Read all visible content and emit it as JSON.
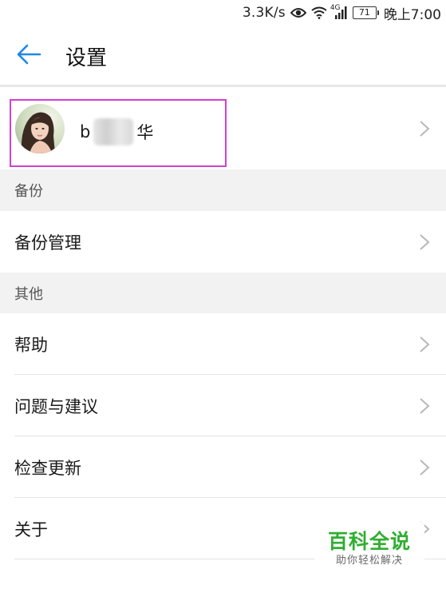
{
  "status_bar": {
    "net_speed": "3.3K/s",
    "network_type": "4G",
    "battery_level": "71",
    "time": "晚上7:00",
    "icons": [
      "eye-icon",
      "wifi-icon",
      "signal-icon",
      "battery-icon"
    ]
  },
  "header": {
    "back_icon": "arrow-left-icon",
    "title": "设置"
  },
  "profile": {
    "name_first": "b",
    "name_last": "华",
    "avatar_icon": "user-avatar"
  },
  "sections": {
    "backup": {
      "title": "备份",
      "items": [
        {
          "label": "备份管理"
        }
      ]
    },
    "other": {
      "title": "其他",
      "items": [
        {
          "label": "帮助"
        },
        {
          "label": "问题与建议"
        },
        {
          "label": "检查更新"
        },
        {
          "label": "关于"
        }
      ]
    }
  },
  "watermark": {
    "title": "百科全说",
    "subtitle": "助你轻松解决"
  },
  "colors": {
    "accent": "#1e88e5",
    "highlight_border": "#d43fd4",
    "section_bg": "#f2f2f2",
    "watermark_green": "#2fae2f"
  }
}
